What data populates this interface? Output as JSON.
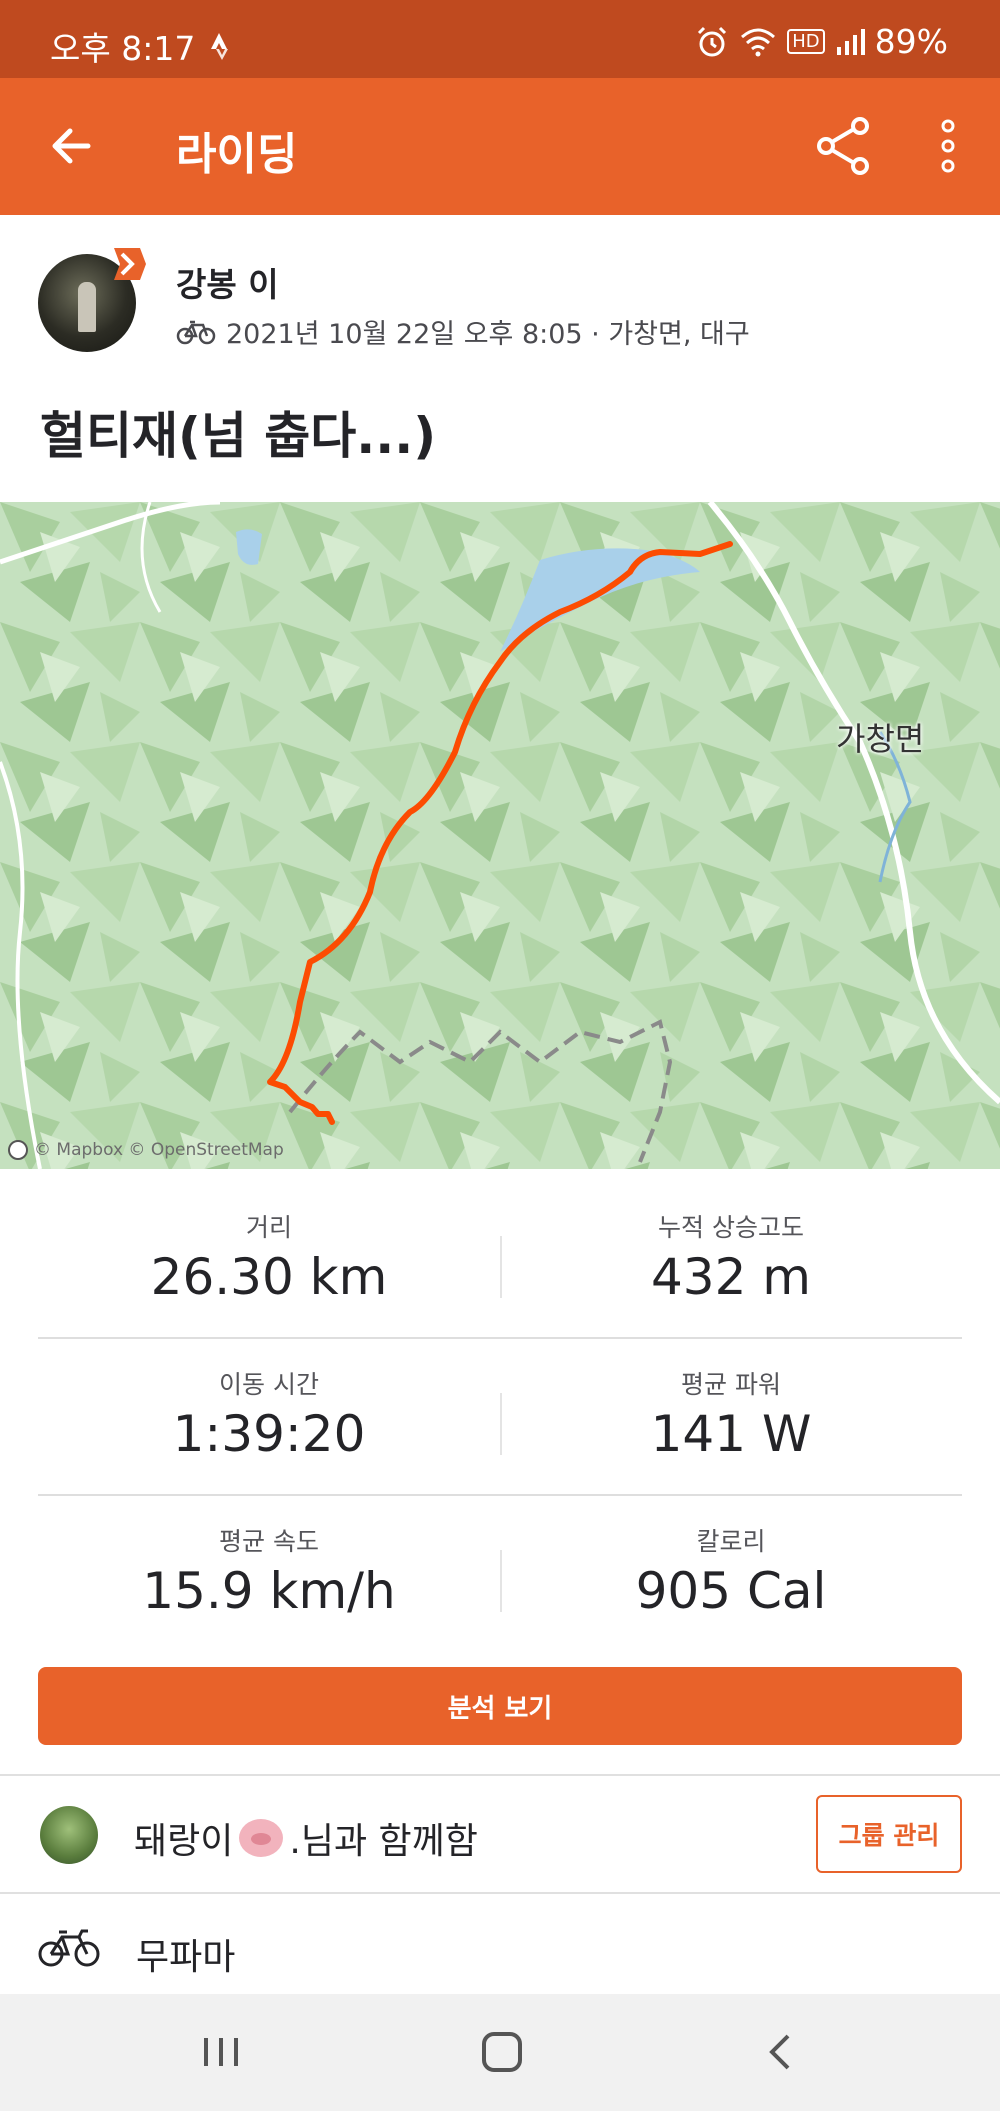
{
  "status_bar": {
    "time": "오후 8:17",
    "battery": "89%",
    "hd_label": "HD"
  },
  "app_bar": {
    "title": "라이딩"
  },
  "athlete": {
    "name": "강봉 이",
    "meta": "2021년 10월 22일 오후 8:05 · 가창면, 대구"
  },
  "activity": {
    "title": "헐티재(넘 춥다...)"
  },
  "map": {
    "place_label": "가창면",
    "attribution": "© Mapbox © OpenStreetMap",
    "route_color": "#fc4c02"
  },
  "stats": [
    {
      "left_label": "거리",
      "left_value": "26.30 km",
      "right_label": "누적 상승고도",
      "right_value": "432 m"
    },
    {
      "left_label": "이동 시간",
      "left_value": "1:39:20",
      "right_label": "평균 파워",
      "right_value": "141 W"
    },
    {
      "left_label": "평균 속도",
      "left_value": "15.9 km/h",
      "right_label": "칼로리",
      "right_value": "905 Cal"
    }
  ],
  "analysis_button": "분석 보기",
  "group": {
    "text_before": "돼랑이",
    "text_after": ".님과 함께함",
    "manage_button": "그룹 관리"
  },
  "gear": {
    "name": "무파마"
  },
  "colors": {
    "brand": "#e8622a",
    "status_bar": "#bf4a1f"
  }
}
